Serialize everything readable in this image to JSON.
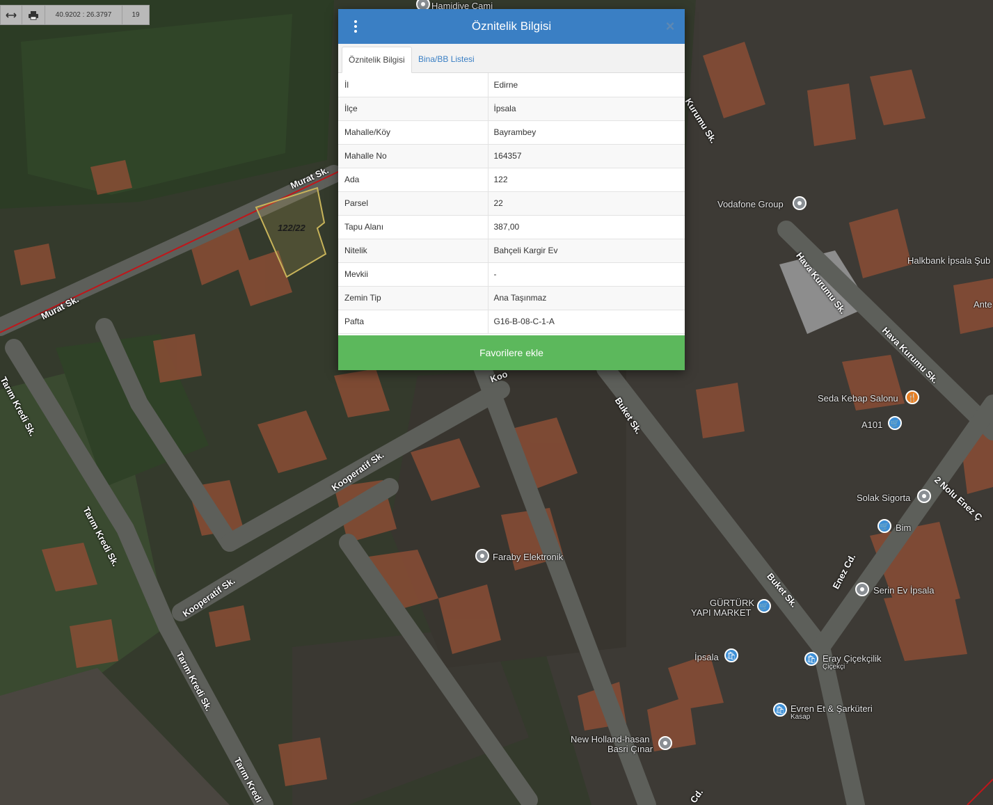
{
  "toolbar": {
    "coordinates": "40.9202 : 26.3797",
    "zoom": "19"
  },
  "map": {
    "parcel_label": "122/22",
    "streets": [
      "Murat Sk.",
      "Murat Sk.",
      "Tarım Kredi Sk.",
      "Tarım Kredi Sk.",
      "Tarım Kredi Sk.",
      "Tarım Kredi",
      "Kooperatif Sk.",
      "Kooperatif Sk.",
      "Buket Sk.",
      "Buket Sk.",
      "Hava Kurumu Sk.",
      "Hava Kurumu Sk.",
      "Enez Cd.",
      "2 Nolu Enez Ç",
      "Kurumu Sk.",
      "Cd.",
      "Koo"
    ],
    "places": [
      {
        "name": "Hamidiye Cami",
        "icon": "mosque-icon"
      },
      {
        "name": "Vodafone Group",
        "icon": "place-icon"
      },
      {
        "name": "Halkbank İpsala Şub",
        "icon": "bank-icon"
      },
      {
        "name": "Ante",
        "icon": "place-icon"
      },
      {
        "name": "Seda Kebap Salonu",
        "icon": "restaurant-icon"
      },
      {
        "name": "A101",
        "icon": "shopping-cart-icon"
      },
      {
        "name": "Solak Sigorta",
        "icon": "place-icon"
      },
      {
        "name": "Bim",
        "icon": "shopping-cart-icon"
      },
      {
        "name": "Faraby Elektronik",
        "icon": "place-icon"
      },
      {
        "name": "Serin Ev İpsala",
        "icon": "place-icon"
      },
      {
        "name": "GÜRTÜRK",
        "icon": "shopping-cart-icon"
      },
      {
        "name": "YAPI MARKET",
        "icon": "shopping-cart-icon"
      },
      {
        "name": "İpsala",
        "icon": "shopping-bag-icon"
      },
      {
        "name": "Eray Çiçekçilik",
        "icon": "shopping-bag-icon"
      },
      {
        "name": "Çiçekçi",
        "icon": "shopping-bag-icon"
      },
      {
        "name": "Evren Et & Şarküteri",
        "icon": "shopping-bag-icon"
      },
      {
        "name": "Kasap",
        "icon": "shopping-bag-icon"
      },
      {
        "name": "New Holland-hasan",
        "icon": "place-icon"
      },
      {
        "name": "Basri Çınar",
        "icon": "place-icon"
      }
    ]
  },
  "dialog": {
    "title": "Öznitelik Bilgisi",
    "close": "×",
    "tabs": [
      {
        "label": "Öznitelik Bilgisi",
        "active": true
      },
      {
        "label": "Bina/BB Listesi",
        "active": false
      }
    ],
    "rows": [
      {
        "key": "İl",
        "value": "Edirne"
      },
      {
        "key": "İlçe",
        "value": "İpsala"
      },
      {
        "key": "Mahalle/Köy",
        "value": "Bayrambey"
      },
      {
        "key": "Mahalle No",
        "value": "164357"
      },
      {
        "key": "Ada",
        "value": "122"
      },
      {
        "key": "Parsel",
        "value": "22"
      },
      {
        "key": "Tapu Alanı",
        "value": "387,00"
      },
      {
        "key": "Nitelik",
        "value": "Bahçeli Kargir Ev"
      },
      {
        "key": "Mevkii",
        "value": "-"
      },
      {
        "key": "Zemin Tip",
        "value": "Ana Taşınmaz"
      },
      {
        "key": "Pafta",
        "value": "G16-B-08-C-1-A"
      }
    ],
    "button_label": "Favorilere ekle"
  },
  "colors": {
    "header": "#3a7fc4",
    "button": "#5cb85c",
    "parcel_outline": "#c8b45a",
    "boundary_line": "#c0161a"
  }
}
